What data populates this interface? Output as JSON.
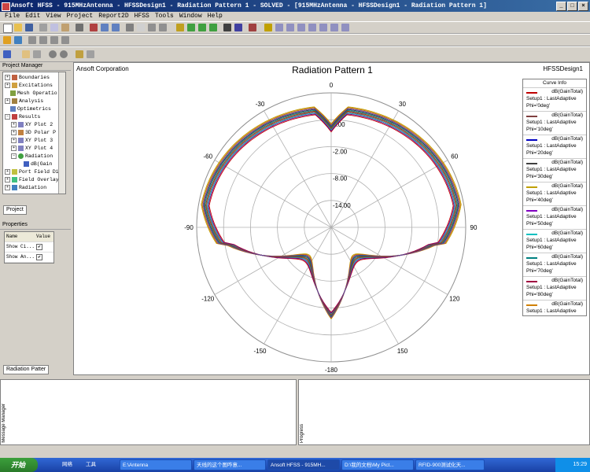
{
  "window": {
    "title": "Ansoft HFSS - 915MHzAntenna - HFSSDesign1 - Radiation Pattern 1 - SOLVED - [915MHzAntenna - HFSSDesign1 - Radiation Pattern 1]"
  },
  "menu": [
    "File",
    "Edit",
    "View",
    "Project",
    "Report2D",
    "HFSS",
    "Tools",
    "Window",
    "Help"
  ],
  "project_manager": {
    "header": "Project Manager",
    "items": [
      "Boundaries",
      "Excitations",
      "Mesh Operatio",
      "Analysis",
      "Optimetrics",
      "Results",
      "XY Plot 2",
      "3D Polar P",
      "XY Plot 3",
      "XY Plot 4",
      "Radiation",
      "dB(Gain",
      "Port Field Di",
      "Field Overlay",
      "Radiation"
    ],
    "tab": "Project"
  },
  "properties": {
    "header": "Properties",
    "col_name": "Name",
    "col_value": "Value",
    "rows": [
      {
        "name": "Show Ci...",
        "checked": "✔"
      },
      {
        "name": "Show An...",
        "checked": "✔"
      }
    ],
    "tab": "Radiation Patter"
  },
  "plot": {
    "company": "Ansoft Corporation",
    "title": "Radiation Pattern 1",
    "design": "HFSSDesign1",
    "angle_labels": [
      "0",
      "30",
      "60",
      "90",
      "120",
      "150",
      "-180",
      "-150",
      "-120",
      "-90",
      "-60",
      "-30"
    ],
    "radial_labels": [
      "4.00",
      "-2.00",
      "-8.00",
      "-14.00"
    ]
  },
  "legend": {
    "title": "Curve Info",
    "items": [
      {
        "name": "dB(GainTotal)",
        "setup": "Setup1 : LastAdaptive",
        "phi": "Phi='0deg'",
        "color": "#c00000"
      },
      {
        "name": "dB(GainTotal)",
        "setup": "Setup1 : LastAdaptive",
        "phi": "Phi='10deg'",
        "color": "#804040"
      },
      {
        "name": "dB(GainTotal)",
        "setup": "Setup1 : LastAdaptive",
        "phi": "Phi='20deg'",
        "color": "#0000c0"
      },
      {
        "name": "dB(GainTotal)",
        "setup": "Setup1 : LastAdaptive",
        "phi": "Phi='30deg'",
        "color": "#404040"
      },
      {
        "name": "dB(GainTotal)",
        "setup": "Setup1 : LastAdaptive",
        "phi": "Phi='40deg'",
        "color": "#c0a000"
      },
      {
        "name": "dB(GainTotal)",
        "setup": "Setup1 : LastAdaptive",
        "phi": "Phi='50deg'",
        "color": "#8000c0"
      },
      {
        "name": "dB(GainTotal)",
        "setup": "Setup1 : LastAdaptive",
        "phi": "Phi='60deg'",
        "color": "#00c0c0"
      },
      {
        "name": "dB(GainTotal)",
        "setup": "Setup1 : LastAdaptive",
        "phi": "Phi='70deg'",
        "color": "#008080"
      },
      {
        "name": "dB(GainTotal)",
        "setup": "Setup1 : LastAdaptive",
        "phi": "Phi='80deg'",
        "color": "#a00040"
      },
      {
        "name": "dB(GainTotal)",
        "setup": "Setup1 : LastAdaptive",
        "phi": "",
        "color": "#d08000"
      }
    ]
  },
  "panels": {
    "message_label": "Message Manager",
    "progress_label": "Progress"
  },
  "taskbar": {
    "start": "开始",
    "buttons": [
      "网络",
      "工具",
      "E:\\Antenna",
      "天线的这个图咋意...",
      "Ansoft HFSS - 915MH...",
      "D:\\我的文档\\My Pict...",
      "RFID-900测试化天..."
    ],
    "clock": "15:29"
  },
  "chart_data": {
    "type": "polar",
    "title": "Radiation Pattern 1",
    "angle_labels_deg": [
      0,
      30,
      60,
      90,
      120,
      150,
      -180,
      -150,
      -120,
      -90,
      -60,
      -30
    ],
    "radial_ticks_db": [
      4.0,
      -2.0,
      -8.0,
      -14.0
    ],
    "series_count": 10
  }
}
